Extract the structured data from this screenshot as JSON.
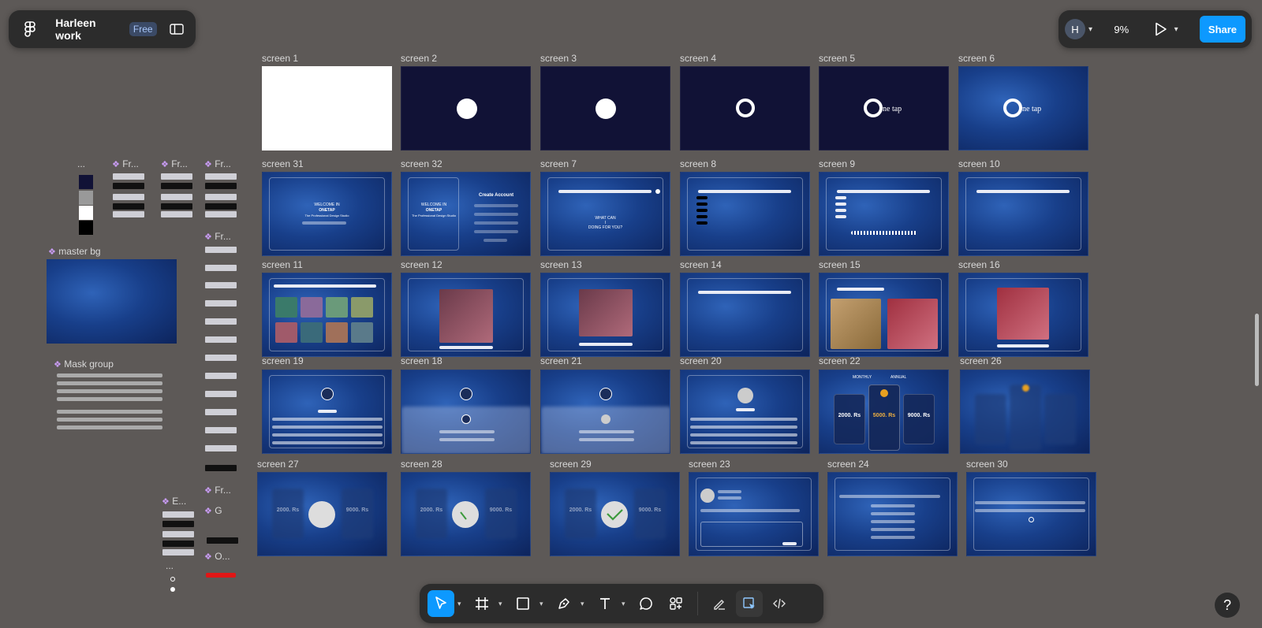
{
  "header": {
    "file_name": "Harleen work",
    "plan_badge": "Free",
    "avatar_initial": "H",
    "zoom": "9%",
    "share_label": "Share"
  },
  "toolbar": {
    "tools": [
      "move-tool",
      "frame-tool",
      "shape-tool",
      "pen-tool",
      "text-tool",
      "comment-tool",
      "actions-tool"
    ],
    "mode_buttons": [
      "draw-mode",
      "design-mode",
      "dev-mode"
    ]
  },
  "help_label": "?",
  "colors": {
    "accent": "#0d99ff",
    "canvas": "#5d5957",
    "panel": "#2c2c2c",
    "frame_blue": "#183f8a",
    "frame_navy": "#111236"
  },
  "frames": {
    "f1": "screen 1",
    "f2": "screen 2",
    "f3": "screen 3",
    "f4": "screen 4",
    "f5": "screen 5",
    "f6": "screen 6",
    "f31": "screen 31",
    "f32": "screen 32",
    "f7": "screen  7",
    "f8": "screen  8",
    "f9": "screen  9",
    "f10": "screen 10",
    "f11": "screen 11",
    "f12": "screen  12",
    "f13": "screen  13",
    "f14": "screen 14",
    "f15": "screen 15",
    "f16": "screen  16",
    "f19": "screen 19",
    "f18": "screen 18",
    "f21": "screen 21",
    "f20": "screen 20",
    "f22": "screen 22",
    "f26": "screen 26",
    "f27": "screen 27",
    "f28": "screen 28",
    "f29": "screen 29",
    "f23": "screen 23",
    "f24": "screen 24",
    "f30": "screen 30"
  },
  "frame_text": {
    "welcome": "WELCOME IN",
    "brand": "ONETAP",
    "tagline": "The Professional Design Studio",
    "create_account": "Create Account",
    "what_can": "WHAT CAN",
    "i_label": "I",
    "doing": "DOING FOR YOU?",
    "one_tap": "ne tap",
    "monthly": "MONTHLY",
    "annual": "ANNUAL",
    "price1": "2000. Rs",
    "price2": "5000. Rs",
    "price3": "9000. Rs",
    "price_short1": "2000. Rs",
    "price_short2": "9000. Rs"
  },
  "left_panel": {
    "dots": "...",
    "fr1": "Fr...",
    "fr2": "Fr...",
    "fr3": "Fr...",
    "fr4": "Fr...",
    "master_bg": "master bg",
    "mask_group": "Mask group",
    "fr5": "Fr...",
    "e_label": "E...",
    "g_label": "G",
    "o_label": "O...",
    "dots2": "..."
  }
}
